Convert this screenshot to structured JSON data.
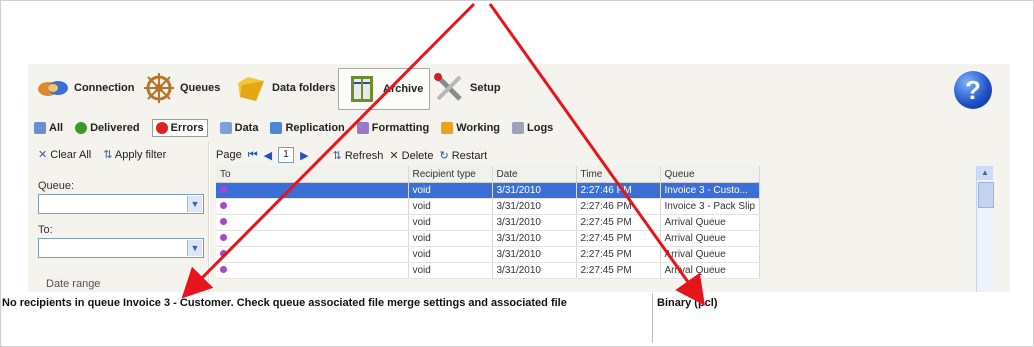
{
  "toolbar": {
    "connection": "Connection",
    "queues": "Queues",
    "data_folders": "Data folders",
    "archive": "Archive",
    "setup": "Setup",
    "help": "?"
  },
  "tabs": {
    "all": "All",
    "delivered": "Delivered",
    "errors": "Errors",
    "data": "Data",
    "replication": "Replication",
    "formatting": "Formatting",
    "working": "Working",
    "logs": "Logs"
  },
  "filter": {
    "clear_all": "Clear All",
    "apply_filter": "Apply filter",
    "queue_label": "Queue:",
    "to_label": "To:",
    "date_range": "Date range"
  },
  "grid_toolbar": {
    "page": "Page",
    "page_num": "1",
    "refresh": "Refresh",
    "delete": "Delete",
    "restart": "Restart"
  },
  "columns": [
    "To",
    "Recipient type",
    "Date",
    "Time",
    "Queue"
  ],
  "rows": [
    {
      "to": "",
      "type": "void",
      "date": "3/31/2010",
      "time": "2:27:46 PM",
      "queue": "Invoice 3 - Custo..."
    },
    {
      "to": "",
      "type": "void",
      "date": "3/31/2010",
      "time": "2:27:46 PM",
      "queue": "Invoice 3 - Pack Slip"
    },
    {
      "to": "",
      "type": "void",
      "date": "3/31/2010",
      "time": "2:27:45 PM",
      "queue": "Arrival Queue"
    },
    {
      "to": "",
      "type": "void",
      "date": "3/31/2010",
      "time": "2:27:45 PM",
      "queue": "Arrival Queue"
    },
    {
      "to": "",
      "type": "void",
      "date": "3/31/2010",
      "time": "2:27:45 PM",
      "queue": "Arrival Queue"
    },
    {
      "to": "",
      "type": "void",
      "date": "3/31/2010",
      "time": "2:27:45 PM",
      "queue": "Arrival Queue"
    }
  ],
  "status": {
    "message": "No recipients in queue Invoice 3 - Customer. Check queue associated file merge settings and associated file",
    "format": "Binary (pcl)"
  },
  "colors": {
    "selection": "#3a6fd8",
    "annotation_arrow": "#e8141b",
    "panel_bg": "#f4f3ee"
  }
}
